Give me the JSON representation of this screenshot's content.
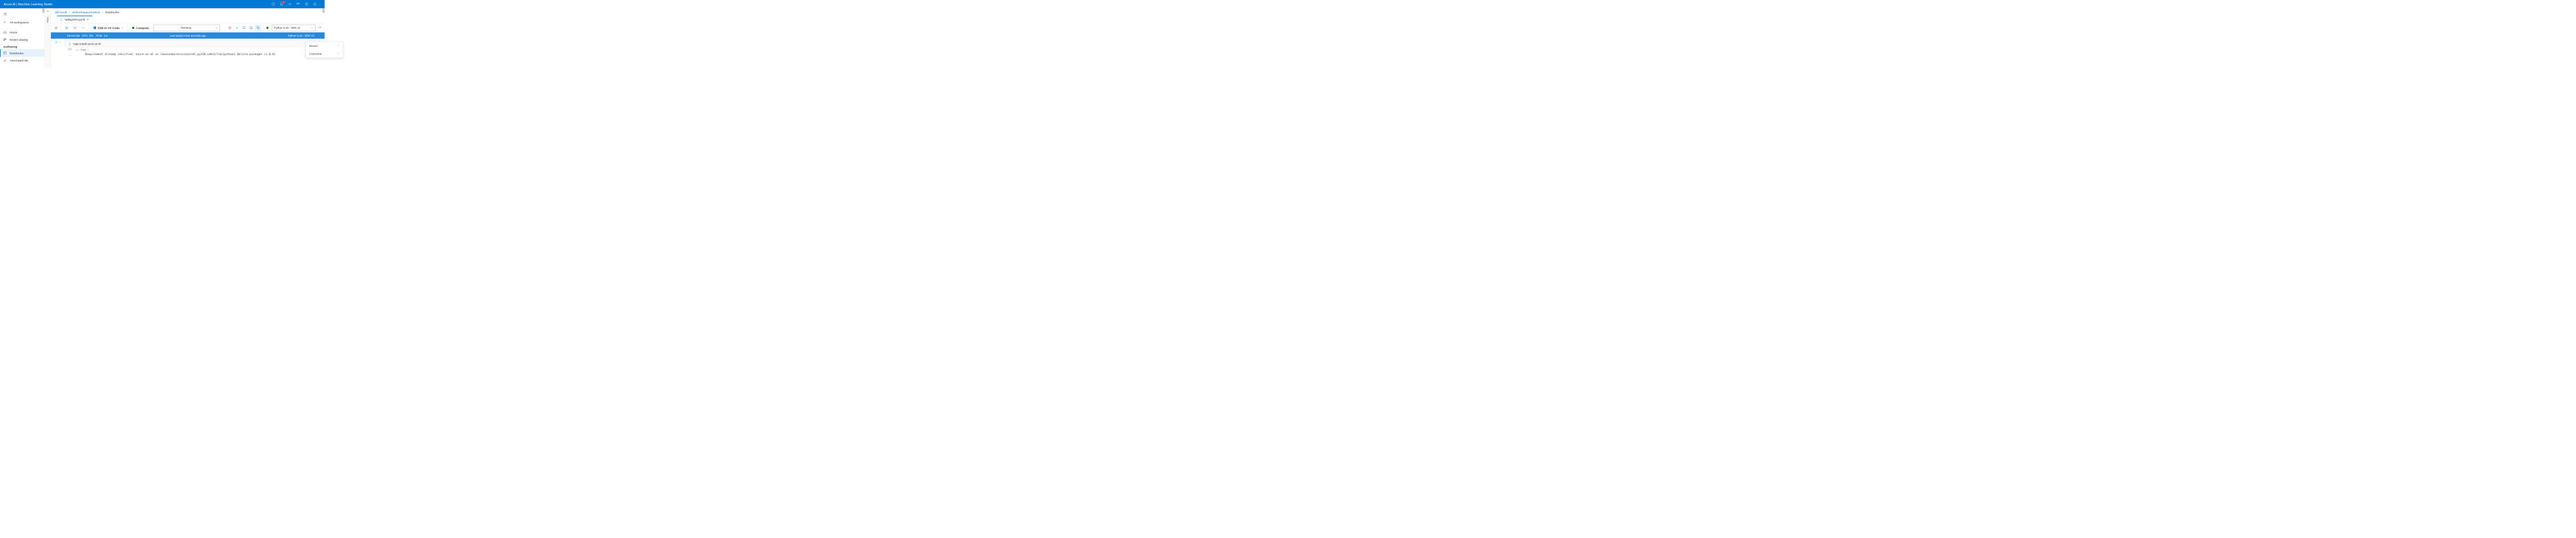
{
  "topbar": {
    "title": "Azure AI | Machine Learning Studio",
    "notification_count": "3"
  },
  "sidebar": {
    "all_workspaces": "All workspaces",
    "home": "Home",
    "model_catalog": "Model catalog",
    "authoring_section": "Authoring",
    "notebooks": "Notebooks",
    "automated_ml": "Automated ML"
  },
  "files_gutter": {
    "label": "Files"
  },
  "breadcrumb": {
    "items": [
      "Microsoft",
      "amlworkspacemidesa",
      "Notebooks"
    ]
  },
  "tab": {
    "filename": "*adlsg2test.ipynb"
  },
  "toolbar": {
    "edit_vscode": "Edit in VS Code",
    "compute_label": "Compute:",
    "compute_value": "-    Running",
    "kernel_value": "Python 3.10 - SDK v2"
  },
  "statusbar": {
    "kernel": "· Kernel idle",
    "cpu_label": "CPU",
    "cpu_value": "0%",
    "ram_label": "RAM",
    "ram_value": "1%",
    "saved": "Last saved a few seconds ago",
    "env": "Python 3.10 - SDK V2"
  },
  "dropdown": {
    "mount": "Mount",
    "consume": "Consume"
  },
  "cell": {
    "line_number": "1",
    "code": "%pip install azure-ai-ml",
    "exec_label": "[1]",
    "exec_time": "3 sec",
    "output": "Requirement already satisfied: azure-ai-ml in /anaconda/envs/azureml_py310_sdkv2/lib/python3.10/site-packages (1.8.0)"
  }
}
